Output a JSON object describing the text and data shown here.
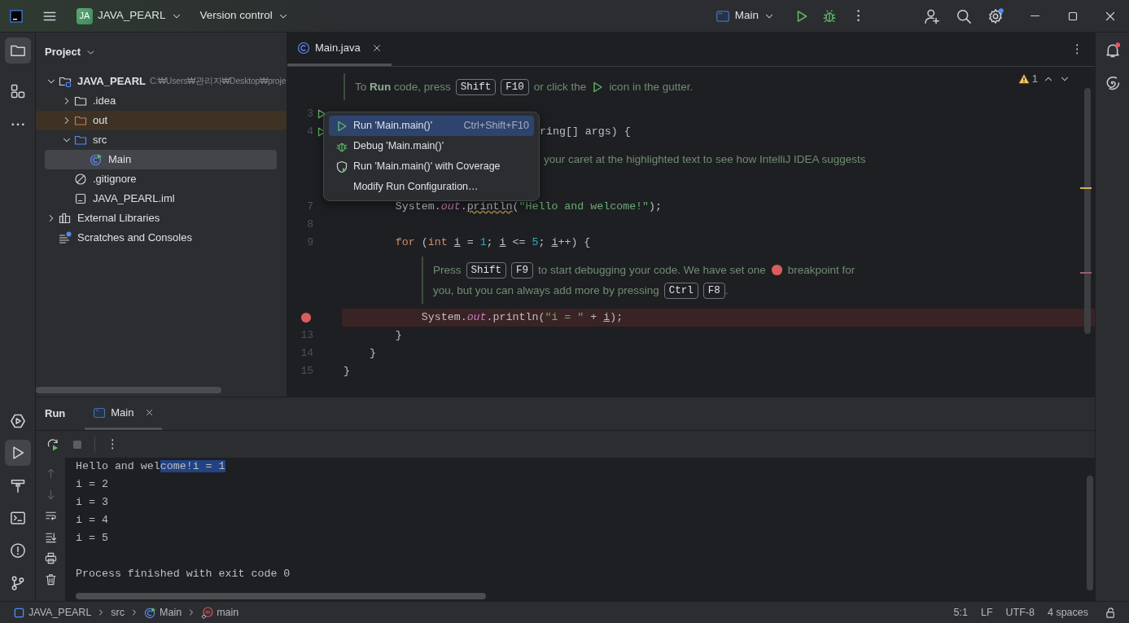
{
  "title_bar": {
    "project_badge": "JA",
    "project": "JAVA_PEARL",
    "vcs": "Version control",
    "run_config": "Main"
  },
  "project_panel": {
    "title": "Project",
    "tree": [
      {
        "label": "JAVA_PEARL",
        "path": "C:₩Users₩관리자₩Desktop₩proje",
        "kind": "module",
        "expanded": true,
        "selected": false,
        "children": [
          {
            "label": ".idea",
            "kind": "folder",
            "expanded": false,
            "selected": false
          },
          {
            "label": "out",
            "kind": "excluded",
            "expanded": false,
            "selected": false
          },
          {
            "label": "src",
            "kind": "source",
            "expanded": true,
            "selected": false,
            "children": [
              {
                "label": "Main",
                "kind": "class",
                "selected": true
              }
            ]
          },
          {
            "label": ".gitignore",
            "kind": "ignore",
            "selected": false
          },
          {
            "label": "JAVA_PEARL.iml",
            "kind": "iml",
            "selected": false
          }
        ]
      },
      {
        "label": "External Libraries",
        "kind": "libraries",
        "expanded": false,
        "selected": false
      },
      {
        "label": "Scratches and Consoles",
        "kind": "scratches",
        "selected": false
      }
    ]
  },
  "editor": {
    "tabs": [
      {
        "label": "Main.java",
        "selected": true
      }
    ],
    "warnings": "1",
    "lines": [
      {
        "kind": "doc",
        "parts": [
          {
            "kind": "text",
            "text": "To **Run** code, press"
          },
          {
            "kind": "key",
            "text": "Shift"
          },
          {
            "kind": "key",
            "text": "F10"
          },
          {
            "kind": "text",
            "text": "or click the"
          },
          {
            "kind": "run-mark"
          },
          {
            "kind": "text",
            "text": "icon in the gutter."
          }
        ]
      },
      {
        "kind": "code",
        "number": "3",
        "runnable": true
      },
      {
        "kind": "covered",
        "number": "4",
        "runnable": true,
        "tokens": [
          {
            "kind": "plain",
            "text": "ring[] args) {"
          }
        ]
      },
      {
        "kind": "doc-covered",
        "parts": [
          {
            "kind": "text",
            "text": "your caret at the highlighted text to see how IntelliJ IDEA suggests"
          }
        ]
      },
      {
        "kind": "code",
        "number": "7",
        "tokens": [
          {
            "kind": "plain",
            "text": "        System."
          },
          {
            "kind": "field",
            "text": "out"
          },
          {
            "kind": "plain",
            "text": "."
          },
          {
            "kind": "warn",
            "text": "println"
          },
          {
            "kind": "plain",
            "text": "("
          },
          {
            "kind": "str",
            "text": "\"Hello and welcome!\""
          },
          {
            "kind": "plain",
            "text": ");"
          }
        ]
      },
      {
        "kind": "code",
        "number": "8"
      },
      {
        "kind": "code",
        "number": "9",
        "tokens": [
          {
            "kind": "kw",
            "text": "        for"
          },
          {
            "kind": "plain",
            "text": " ("
          },
          {
            "kind": "kw",
            "text": "int "
          },
          {
            "kind": "var",
            "text": "i"
          },
          {
            "kind": "plain",
            "text": " = "
          },
          {
            "kind": "num",
            "text": "1"
          },
          {
            "kind": "plain",
            "text": "; "
          },
          {
            "kind": "var",
            "text": "i"
          },
          {
            "kind": "plain",
            "text": " <= "
          },
          {
            "kind": "num",
            "text": "5"
          },
          {
            "kind": "plain",
            "text": "; "
          },
          {
            "kind": "var",
            "text": "i"
          },
          {
            "kind": "plain",
            "text": "++) {"
          }
        ]
      },
      {
        "kind": "doc",
        "parts": [
          {
            "kind": "text",
            "text": "Press"
          },
          {
            "kind": "key",
            "text": "Shift"
          },
          {
            "kind": "key",
            "text": "F9"
          },
          {
            "kind": "text",
            "text": "to start debugging your code. We have set one"
          },
          {
            "kind": "breakpoint-mark"
          },
          {
            "kind": "text",
            "text": "breakpoint for"
          },
          {
            "kind": "break"
          },
          {
            "kind": "text",
            "text": "you, but you can always add more by pressing"
          },
          {
            "kind": "key",
            "text": "Ctrl"
          },
          {
            "kind": "key",
            "text": "F8"
          },
          {
            "kind": "text",
            "text": "."
          }
        ]
      },
      {
        "kind": "code",
        "breakpoint": true,
        "tokens": [
          {
            "kind": "plain",
            "text": "            System."
          },
          {
            "kind": "field",
            "text": "out"
          },
          {
            "kind": "plain",
            "text": ".println("
          },
          {
            "kind": "str",
            "text": "\"i = \""
          },
          {
            "kind": "plain",
            "text": " + "
          },
          {
            "kind": "var",
            "text": "i"
          },
          {
            "kind": "plain",
            "text": ");"
          }
        ]
      },
      {
        "kind": "code",
        "number": "13",
        "tokens": [
          {
            "kind": "plain",
            "text": "        }"
          }
        ]
      },
      {
        "kind": "code",
        "number": "14",
        "tokens": [
          {
            "kind": "plain",
            "text": "    }"
          }
        ]
      },
      {
        "kind": "code",
        "number": "15",
        "tokens": [
          {
            "kind": "plain",
            "text": "}"
          }
        ]
      }
    ]
  },
  "context_menu": {
    "items": [
      {
        "label": "Run 'Main.main()'",
        "shortcut": "Ctrl+Shift+F10",
        "kind": "run",
        "selected": true
      },
      {
        "label": "Debug 'Main.main()'",
        "kind": "debug",
        "selected": false
      },
      {
        "label": "Run 'Main.main()' with Coverage",
        "kind": "coverage",
        "selected": false
      },
      {
        "label": "Modify Run Configuration…",
        "kind": "plain",
        "selected": false
      }
    ]
  },
  "run_panel": {
    "title": "Run",
    "tabs": [
      {
        "label": "Main",
        "selected": true
      }
    ],
    "output": [
      {
        "text": "Hello and wel",
        "selection": "come!i = 1"
      },
      {
        "text": "i = 2"
      },
      {
        "text": "i = 3"
      },
      {
        "text": "i = 4"
      },
      {
        "text": "i = 5"
      },
      {
        "text": "Process finished with exit code 0",
        "kind": "exit"
      }
    ]
  },
  "status_bar": {
    "breadcrumbs": [
      {
        "label": "JAVA_PEARL",
        "kind": "module"
      },
      {
        "label": "src",
        "kind": "folder"
      },
      {
        "label": "Main",
        "kind": "class"
      },
      {
        "label": "main",
        "kind": "method"
      }
    ],
    "items": [
      "5:1",
      "LF",
      "UTF-8",
      "4 spaces"
    ]
  }
}
